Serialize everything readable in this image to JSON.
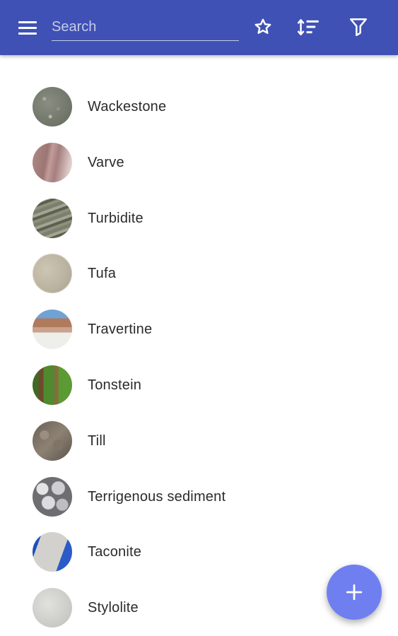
{
  "search": {
    "placeholder": "Search",
    "value": ""
  },
  "toolbar": {
    "menu_icon": "hamburger-menu-icon",
    "favorites_icon": "star-outline-icon",
    "sort_icon": "sort-icon",
    "filter_icon": "filter-funnel-icon"
  },
  "colors": {
    "appbar": "#3f51b5",
    "search_underline": "#c5cae9",
    "fab": "#6f7ff0",
    "text": "#2b2b2b"
  },
  "rocks": [
    {
      "name": "Wackestone",
      "thumb": "wackestone-thumbnail"
    },
    {
      "name": "Varve",
      "thumb": "varve-thumbnail"
    },
    {
      "name": "Turbidite",
      "thumb": "turbidite-thumbnail"
    },
    {
      "name": "Tufa",
      "thumb": "tufa-thumbnail"
    },
    {
      "name": "Travertine",
      "thumb": "travertine-thumbnail"
    },
    {
      "name": "Tonstein",
      "thumb": "tonstein-thumbnail"
    },
    {
      "name": "Till",
      "thumb": "till-thumbnail"
    },
    {
      "name": "Terrigenous sediment",
      "thumb": "terrigenous-sediment-thumbnail"
    },
    {
      "name": "Taconite",
      "thumb": "taconite-thumbnail"
    },
    {
      "name": "Stylolite",
      "thumb": "stylolite-thumbnail"
    }
  ],
  "fab": {
    "icon": "plus-icon"
  }
}
